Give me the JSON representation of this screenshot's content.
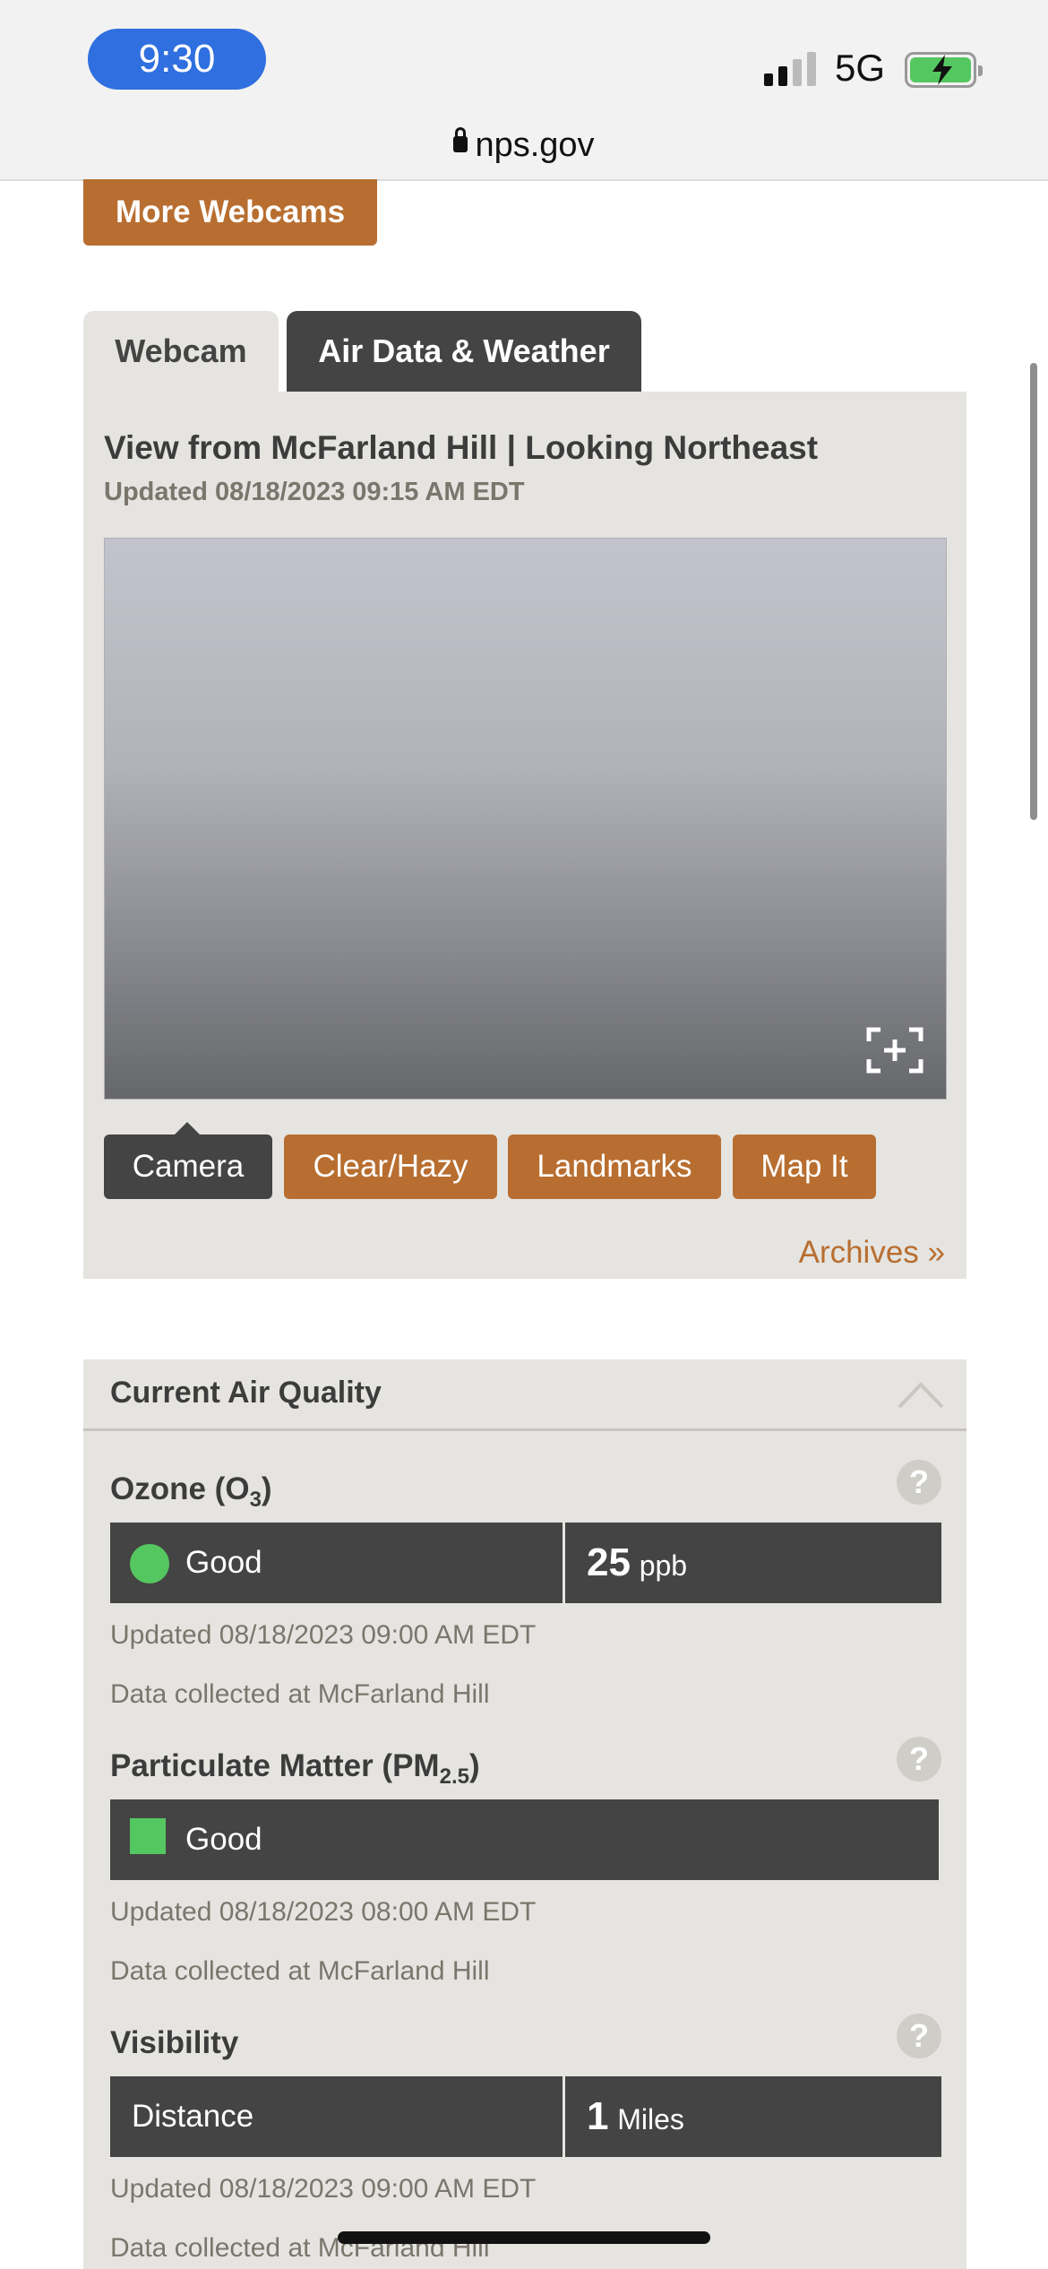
{
  "status_bar": {
    "time": "9:30",
    "network": "5G",
    "battery_charging": true,
    "colors": {
      "time_pill": "#2f6fdf",
      "battery": "#55c760"
    }
  },
  "browser": {
    "url": "nps.gov",
    "lock_icon": "lock-icon"
  },
  "page": {
    "more_webcams": "More Webcams",
    "tabs": [
      {
        "label": "Webcam",
        "active": true
      },
      {
        "label": "Air Data & Weather",
        "active": false
      }
    ],
    "webcam": {
      "title": "View from McFarland Hill | Looking Northeast",
      "updated": "Updated 08/18/2023 09:15 AM EDT",
      "expand_icon": "fullscreen-expand-icon",
      "buttons": [
        "Camera",
        "Clear/Hazy",
        "Landmarks",
        "Map It"
      ],
      "archives": "Archives »"
    },
    "air_quality": {
      "title": "Current Air Quality",
      "collapse_icon": "chevron-up-icon",
      "ozone": {
        "title_main": "Ozone (O",
        "title_sub": "3",
        "title_end": ")",
        "status": "Good",
        "value": "25",
        "unit": "ppb",
        "updated": "Updated 08/18/2023 09:00 AM EDT",
        "collected": "Data collected at McFarland Hill"
      },
      "pm": {
        "title_main": "Particulate Matter (PM",
        "title_sub": "2.5",
        "title_end": ")",
        "status": "Good",
        "updated": "Updated 08/18/2023 08:00 AM EDT",
        "collected": "Data collected at McFarland Hill"
      },
      "visibility": {
        "title": "Visibility",
        "label": "Distance",
        "value": "1",
        "unit": "Miles",
        "updated": "Updated 08/18/2023 09:00 AM EDT",
        "collected": "Data collected at McFarland Hill"
      },
      "help_glyph": "?"
    },
    "colors": {
      "accent": "#b86e30",
      "dark": "#444444",
      "panel": "#e5e4e1",
      "good": "#55c760"
    }
  }
}
